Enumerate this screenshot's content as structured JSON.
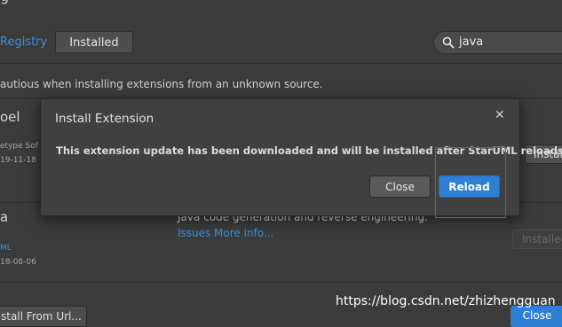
{
  "background": {
    "title_fragment": "g",
    "tabs": {
      "registry": "Registry",
      "installed": "Installed"
    },
    "search": {
      "value": "java",
      "icon": "search-icon"
    },
    "warning": "autious when installing extensions from an unknown source.",
    "extension1": {
      "name": "oel",
      "meta": "etype Sof",
      "date": "19-11-18",
      "install_label": "Install"
    },
    "extension2": {
      "name": "a",
      "description": "Java code generation and reverse engineering.",
      "links": [
        "Issues",
        "More info..."
      ],
      "author": "ML",
      "date": "18-08-06",
      "status_label": "Installed"
    },
    "footer": {
      "install_from_url": "stall From Url...",
      "close": "Close"
    },
    "watermark": "https://blog.csdn.net/zhizhengguan"
  },
  "modal": {
    "title": "Install Extension",
    "close_icon": "close-icon",
    "message": "This extension update has been downloaded and will be installed after StarUML reloads.",
    "buttons": {
      "close": "Close",
      "reload": "Reload"
    }
  },
  "colors": {
    "accent": "#2f7fd6",
    "link": "#3a8fd9",
    "highlight_box": "#d23a3a"
  }
}
